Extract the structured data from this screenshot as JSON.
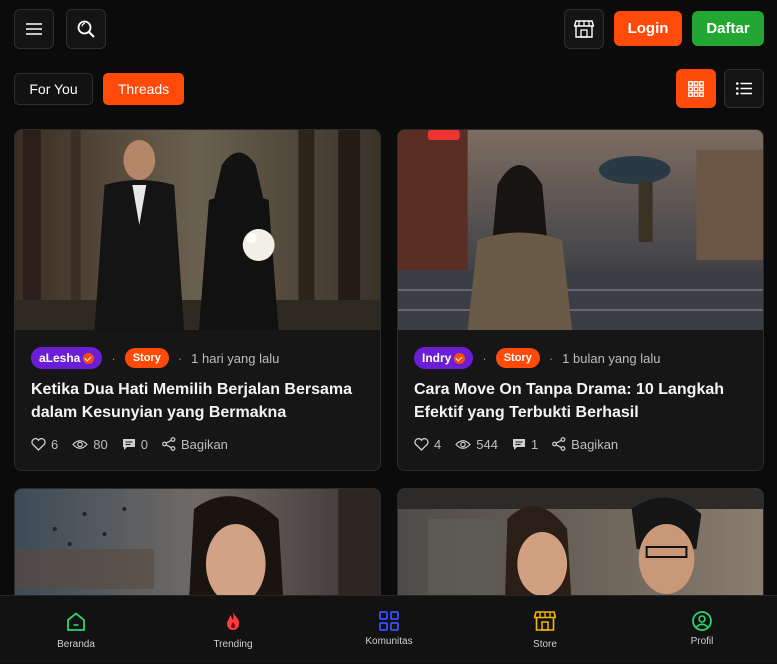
{
  "header": {
    "login_label": "Login",
    "register_label": "Daftar"
  },
  "tabs": [
    {
      "label": "For You",
      "active": false
    },
    {
      "label": "Threads",
      "active": true
    }
  ],
  "view_mode": "grid",
  "posts": [
    {
      "author": "aLesha",
      "verified": true,
      "category": "Story",
      "time": "1 hari yang lalu",
      "title": "Ketika Dua Hati Memilih Berjalan Bersama dalam Kesunyian yang Bermakna",
      "likes": "6",
      "views": "80",
      "comments": "0",
      "share_label": "Bagikan"
    },
    {
      "author": "Indry",
      "verified": true,
      "category": "Story",
      "time": "1 bulan yang lalu",
      "title": "Cara Move On Tanpa Drama: 10 Langkah Efektif yang Terbukti Berhasil",
      "likes": "4",
      "views": "544",
      "comments": "1",
      "share_label": "Bagikan"
    }
  ],
  "bottom_nav": [
    {
      "label": "Beranda",
      "icon": "home-icon",
      "color": "#2bd66a"
    },
    {
      "label": "Trending",
      "icon": "flame-icon",
      "color": "#ff3b3b"
    },
    {
      "label": "Komunitas",
      "icon": "grid-icon",
      "color": "#3c4dff"
    },
    {
      "label": "Store",
      "icon": "store-icon",
      "color": "#f5b800"
    },
    {
      "label": "Profil",
      "icon": "user-icon",
      "color": "#2bd66a"
    }
  ],
  "colors": {
    "accent": "#ff4a0a",
    "success": "#22a832",
    "author_badge": "#6b1ed6",
    "background": "#0b0b0b"
  }
}
